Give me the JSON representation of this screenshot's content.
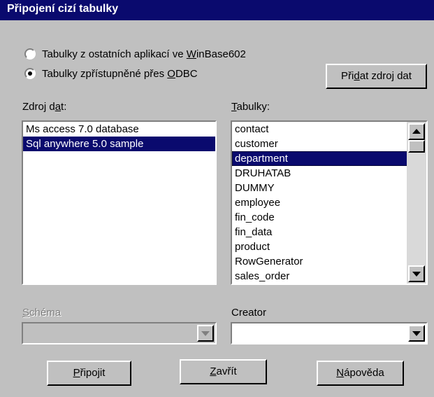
{
  "window": {
    "title": "Připojení cizí tabulky"
  },
  "source_options": [
    {
      "pre": "Tabulky z ostatních aplikací ve ",
      "key": "W",
      "post": "inBase602",
      "selected": false
    },
    {
      "pre": "Tabulky zpřístupněné přes ",
      "key": "O",
      "post": "DBC",
      "selected": true
    }
  ],
  "add_source_button": {
    "pre": "Při",
    "key": "d",
    "post": "at zdroj dat"
  },
  "data_source": {
    "label": {
      "pre": "Zdroj d",
      "key": "a",
      "post": "t:"
    },
    "items": [
      "Ms access 7.0 database",
      "Sql anywhere 5.0 sample"
    ],
    "selected_index": 1
  },
  "tables": {
    "label": {
      "pre": "",
      "key": "T",
      "post": "abulky:"
    },
    "items": [
      "contact",
      "customer",
      "department",
      "DRUHATAB",
      "DUMMY",
      "employee",
      "fin_code",
      "fin_data",
      "product",
      "RowGenerator",
      "sales_order"
    ],
    "selected_index": 2
  },
  "schema": {
    "label": {
      "pre": "",
      "key": "S",
      "post": "chéma"
    },
    "value": "",
    "disabled": true
  },
  "creator": {
    "label": "Creator",
    "value": ""
  },
  "buttons": {
    "connect": {
      "pre": "",
      "key": "P",
      "post": "řipojit"
    },
    "close": {
      "pre": "",
      "key": "Z",
      "post": "avřít"
    },
    "help": {
      "pre": "",
      "key": "N",
      "post": "ápověda"
    }
  },
  "colors": {
    "title_bg": "#0a0a6e",
    "face": "#c0c0c0",
    "selection": "#0a0a6e"
  }
}
